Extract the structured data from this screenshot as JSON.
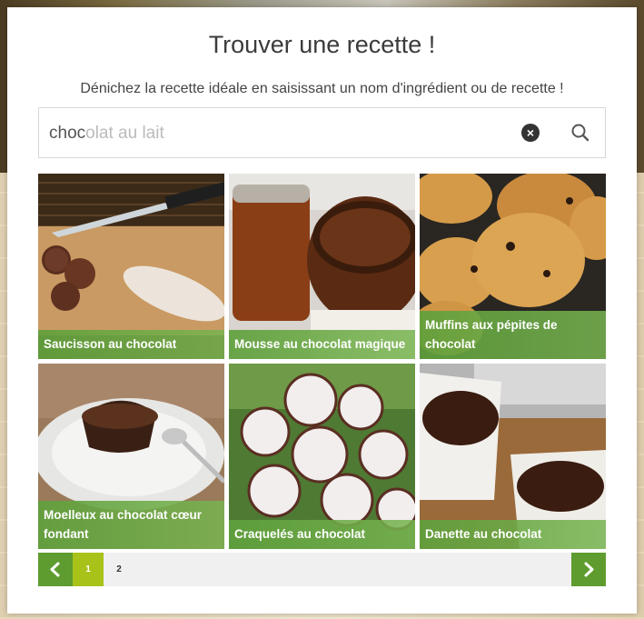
{
  "modal": {
    "title": "Trouver une recette !",
    "subtitle": "Dénichez la recette idéale en saisissant un nom d'ingrédient ou de recette !"
  },
  "search": {
    "typed": "choc",
    "suggestion": "olat au lait",
    "clear_icon": "close-circle-icon",
    "search_icon": "magnifier-icon"
  },
  "recipes": [
    {
      "title": "Saucisson au chocolat"
    },
    {
      "title": "Mousse au chocolat magique"
    },
    {
      "title": "Muffins aux pépites de chocolat"
    },
    {
      "title": "Moelleux au chocolat cœur fondant"
    },
    {
      "title": "Craquelés au chocolat"
    },
    {
      "title": "Danette au chocolat"
    }
  ],
  "pagination": {
    "pages": [
      "1",
      "2"
    ],
    "current": "1",
    "prev_icon": "chevron-left-icon",
    "next_icon": "chevron-right-icon"
  },
  "colors": {
    "accent_green": "#5e9c2f",
    "active_page": "#a9c21a",
    "caption_overlay": "#5fa03c"
  }
}
